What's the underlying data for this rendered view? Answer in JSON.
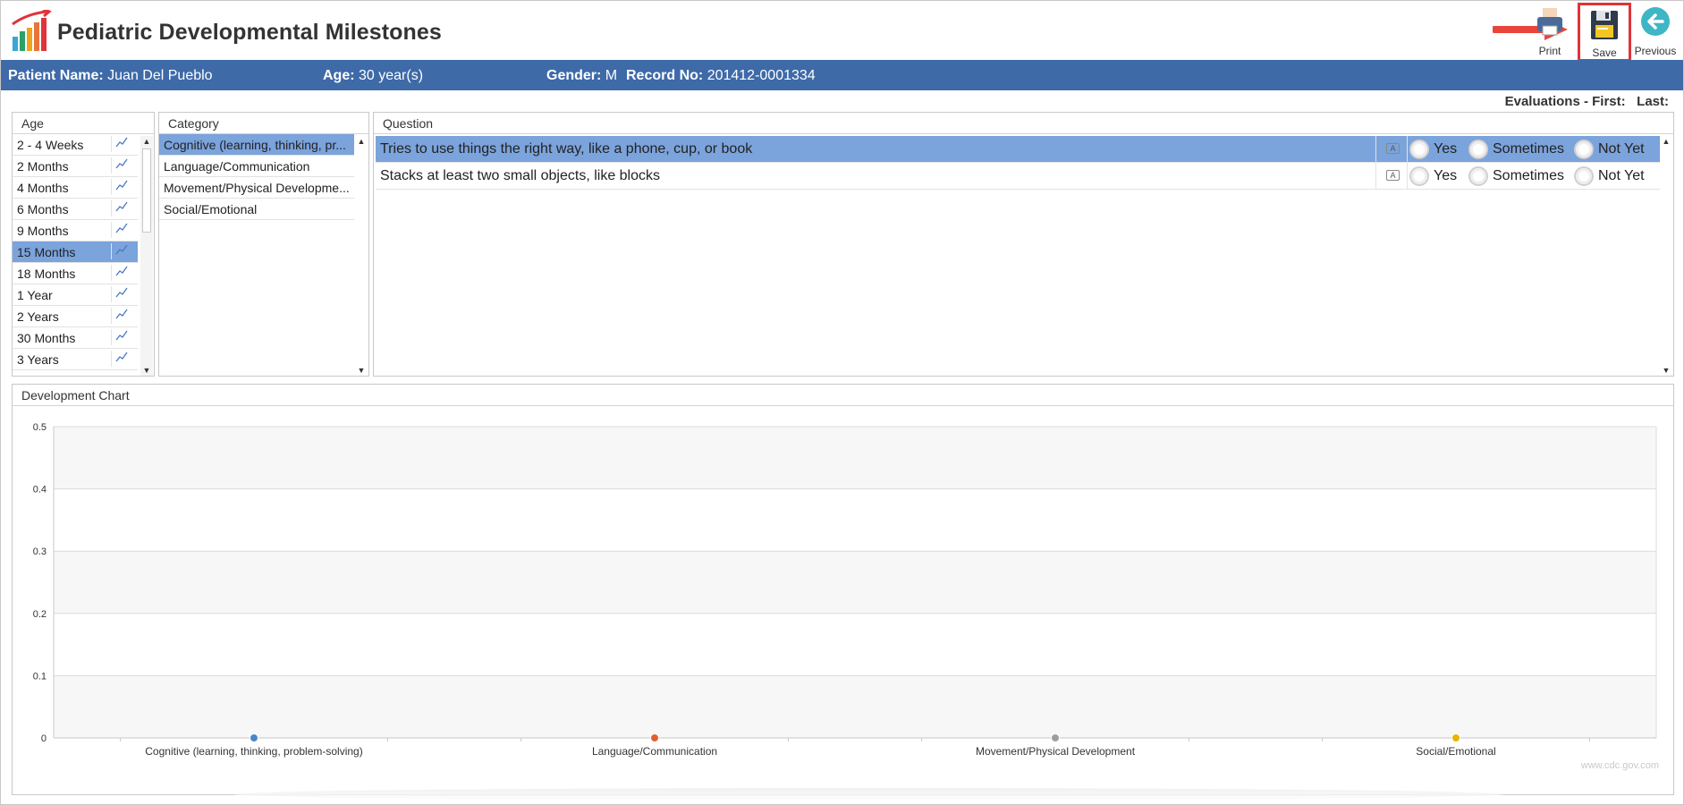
{
  "app": {
    "title": "Pediatric Developmental Milestones"
  },
  "toolbar": {
    "print_label": "Print",
    "save_label": "Save",
    "previous_label": "Previous"
  },
  "patient": {
    "name_label": "Patient Name:",
    "name": "Juan Del Pueblo",
    "age_label": "Age:",
    "age": "30 year(s)",
    "gender_label": "Gender:",
    "gender": "M",
    "record_label": "Record No:",
    "record": "201412-0001334"
  },
  "evaluations": {
    "label": "Evaluations - First:",
    "last_label": "Last:"
  },
  "age_panel": {
    "header": "Age",
    "items": [
      {
        "label": "2 - 4 Weeks",
        "selected": false
      },
      {
        "label": "2 Months",
        "selected": false
      },
      {
        "label": "4 Months",
        "selected": false
      },
      {
        "label": "6 Months",
        "selected": false
      },
      {
        "label": "9 Months",
        "selected": false
      },
      {
        "label": "15 Months",
        "selected": true
      },
      {
        "label": "18 Months",
        "selected": false
      },
      {
        "label": "1 Year",
        "selected": false
      },
      {
        "label": "2 Years",
        "selected": false
      },
      {
        "label": "30 Months",
        "selected": false
      },
      {
        "label": "3 Years",
        "selected": false
      }
    ]
  },
  "category_panel": {
    "header": "Category",
    "items": [
      {
        "label": "Cognitive (learning, thinking, pr...",
        "selected": true
      },
      {
        "label": "Language/Communication",
        "selected": false
      },
      {
        "label": "Movement/Physical Developme...",
        "selected": false
      },
      {
        "label": "Social/Emotional",
        "selected": false
      }
    ]
  },
  "question_panel": {
    "header": "Question",
    "options": [
      "Yes",
      "Sometimes",
      "Not Yet"
    ],
    "items": [
      {
        "text": "Tries to use things the right way, like a phone, cup, or book",
        "selected": true
      },
      {
        "text": "Stacks at least two small objects, like blocks",
        "selected": false
      }
    ]
  },
  "chart_panel": {
    "header": "Development Chart",
    "source": "www.cdc.gov.com"
  },
  "colors": {
    "accent_bar": "#3e6aa8",
    "selection": "#7ba3dc",
    "save_highlight": "#e0343a"
  },
  "chart_data": {
    "type": "line",
    "categories": [
      "Cognitive (learning, thinking, problem-solving)",
      "Language/Communication",
      "Movement/Physical Development",
      "Social/Emotional"
    ],
    "series": [
      {
        "values": [
          0,
          0,
          0,
          0
        ],
        "point_colors": [
          "#4a86c8",
          "#e0612d",
          "#9e9e9e",
          "#e8b400"
        ]
      }
    ],
    "ylim": [
      0,
      0.5
    ],
    "yticks": [
      "0",
      "0.1",
      "0.2",
      "0.3",
      "0.4",
      "0.5"
    ],
    "grid": true,
    "alternating_bands": true
  }
}
